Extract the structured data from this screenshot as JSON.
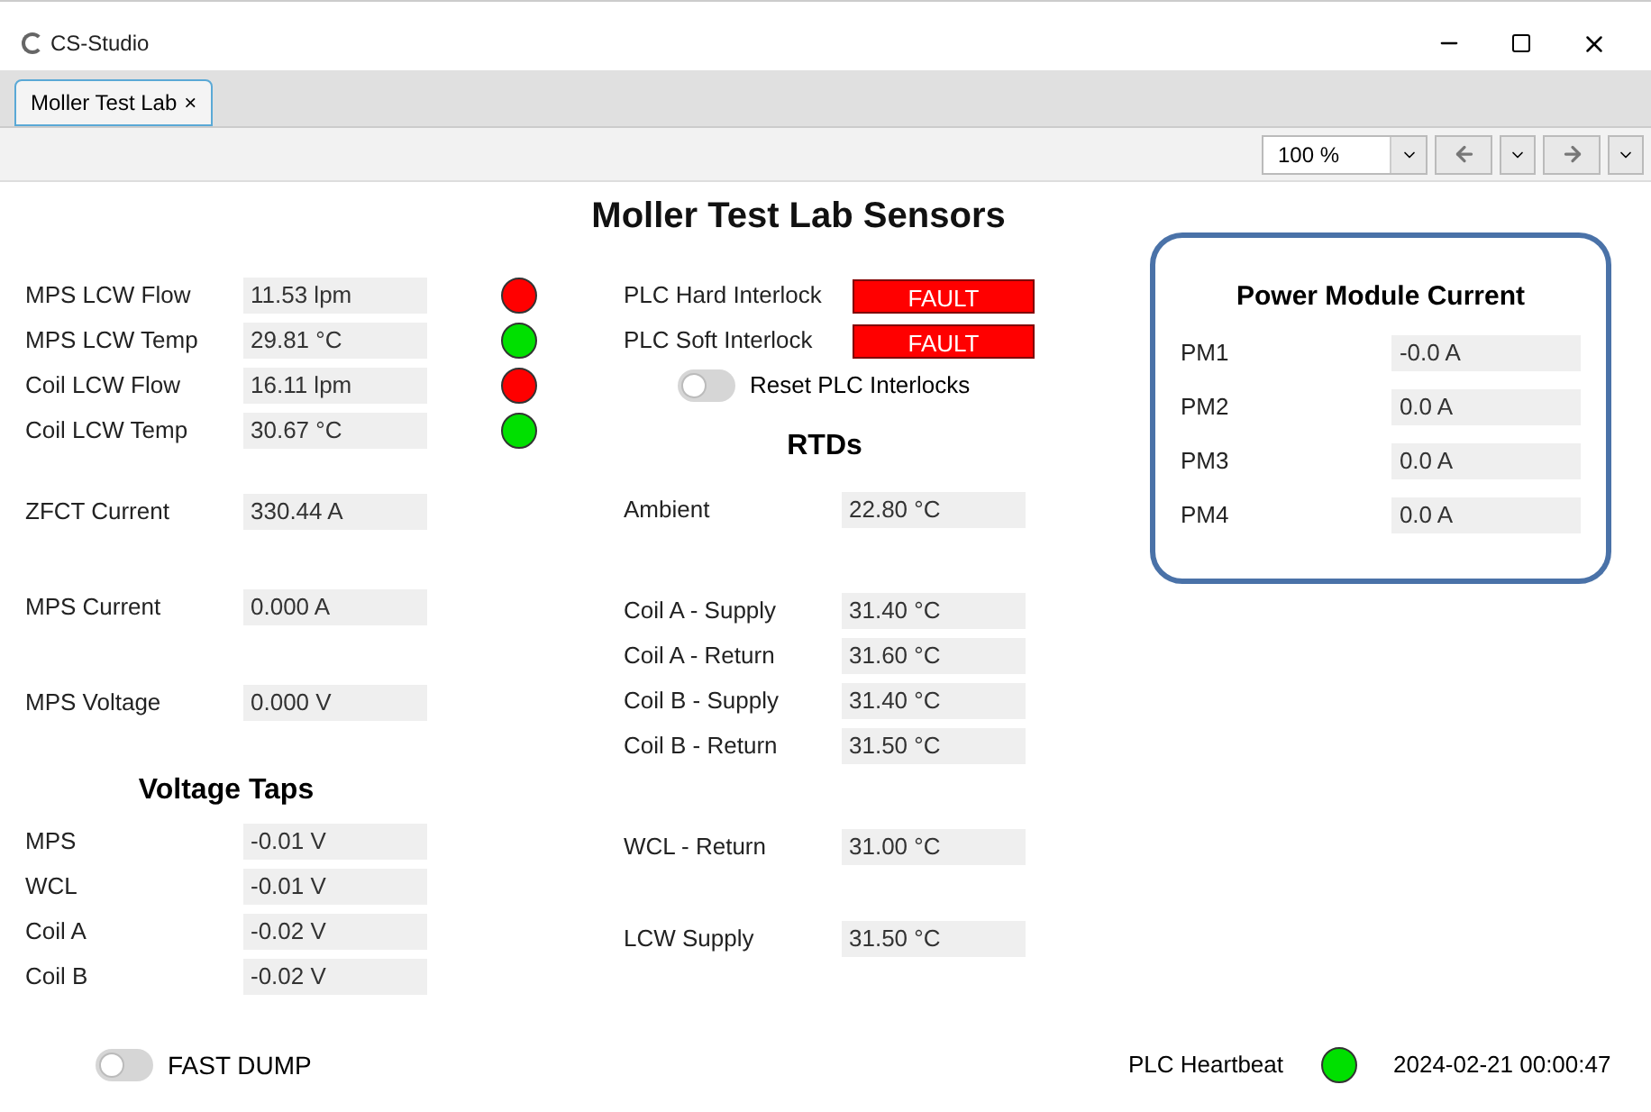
{
  "window": {
    "title": "CS-Studio"
  },
  "tabs": [
    {
      "label": "Moller Test Lab",
      "close": "×",
      "selected": true
    }
  ],
  "toolbar": {
    "zoom": "100 %"
  },
  "display": {
    "title": "Moller Test Lab Sensors",
    "cooling": [
      {
        "label": "MPS LCW Flow",
        "value": "11.53 lpm",
        "color": "#ff0000"
      },
      {
        "label": "MPS LCW Temp",
        "value": "29.81 °C",
        "color": "#00e000"
      },
      {
        "label": "Coil LCW Flow",
        "value": "16.11 lpm",
        "color": "#ff0000"
      },
      {
        "label": "Coil LCW Temp",
        "value": "30.67 °C",
        "color": "#00e000"
      }
    ],
    "magnet": [
      {
        "label": "ZFCT Current",
        "value": "330.44 A"
      },
      {
        "label": "MPS Current",
        "value": "0.000 A"
      },
      {
        "label": "MPS Voltage",
        "value": "0.000 V"
      }
    ],
    "voltage_taps": {
      "title": "Voltage Taps",
      "rows": [
        {
          "label": "MPS",
          "value": "-0.01 V"
        },
        {
          "label": "WCL",
          "value": "-0.01 V"
        },
        {
          "label": "Coil A",
          "value": "-0.02 V"
        },
        {
          "label": "Coil B",
          "value": "-0.02 V"
        }
      ]
    },
    "interlocks": [
      {
        "label": "PLC Hard Interlock",
        "status": "FAULT",
        "fault": true
      },
      {
        "label": "PLC Soft Interlock",
        "status": "FAULT",
        "fault": true
      }
    ],
    "reset_toggle": {
      "label": "Reset PLC Interlocks",
      "on": false
    },
    "rtds": {
      "title": "RTDs",
      "groups": [
        [
          {
            "label": "Ambient",
            "value": "22.80 °C"
          }
        ],
        [
          {
            "label": "Coil A - Supply",
            "value": "31.40 °C"
          },
          {
            "label": "Coil A - Return",
            "value": "31.60 °C"
          },
          {
            "label": "Coil B - Supply",
            "value": "31.40 °C"
          },
          {
            "label": "Coil B - Return",
            "value": "31.50 °C"
          }
        ],
        [
          {
            "label": "WCL - Return",
            "value": "31.00 °C"
          }
        ],
        [
          {
            "label": "LCW Supply",
            "value": "31.50 °C"
          }
        ]
      ]
    },
    "power_modules": {
      "title": "Power Module Current",
      "rows": [
        {
          "label": "PM1",
          "value": "-0.0 A"
        },
        {
          "label": "PM2",
          "value": "0.0 A"
        },
        {
          "label": "PM3",
          "value": "0.0 A"
        },
        {
          "label": "PM4",
          "value": "0.0 A"
        }
      ]
    },
    "fast_dump": {
      "label": "FAST DUMP",
      "on": false
    },
    "heartbeat": {
      "label": "PLC Heartbeat",
      "color": "#00e000"
    },
    "timestamp": "2024-02-21 00:00:47"
  }
}
